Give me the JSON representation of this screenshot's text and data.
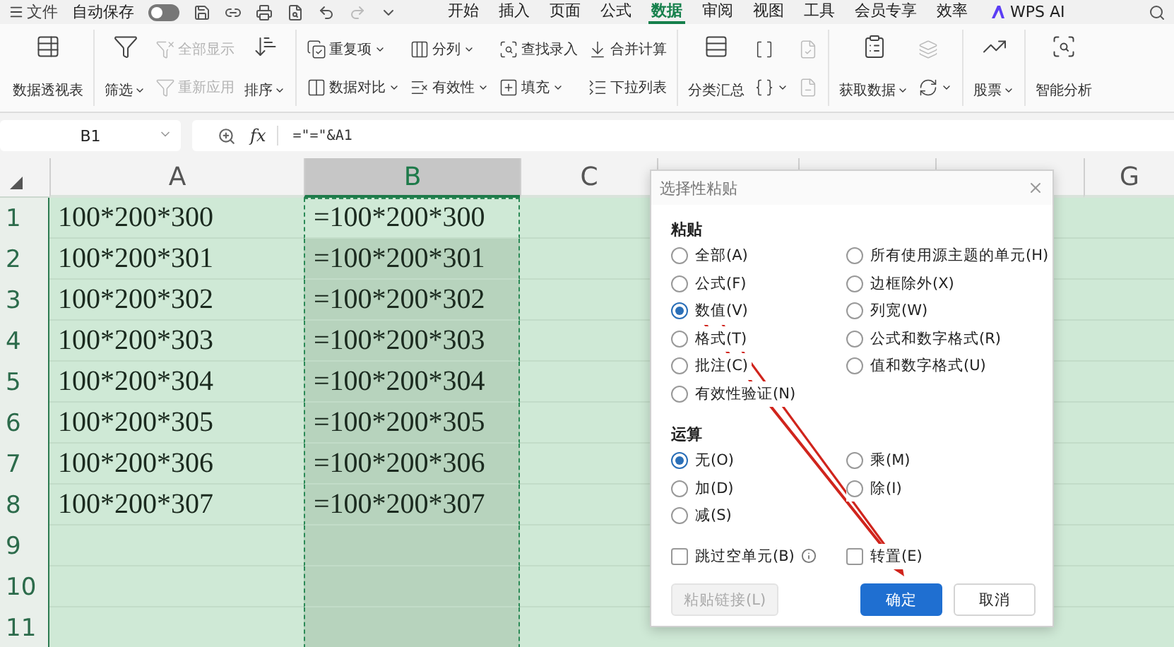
{
  "title_bar": {
    "menu": "文件",
    "autosave": {
      "label": "自动保存",
      "on": false
    },
    "tabs": [
      {
        "label": "开始",
        "selected": false
      },
      {
        "label": "插入",
        "selected": false
      },
      {
        "label": "页面",
        "selected": false
      },
      {
        "label": "公式",
        "selected": false
      },
      {
        "label": "数据",
        "selected": true
      },
      {
        "label": "审阅",
        "selected": false
      },
      {
        "label": "视图",
        "selected": false
      },
      {
        "label": "工具",
        "selected": false
      },
      {
        "label": "会员专享",
        "selected": false
      },
      {
        "label": "效率",
        "selected": false
      }
    ],
    "ai": "WPS AI"
  },
  "ribbon": [
    [
      {
        "kind": "large",
        "label": "数据透视表",
        "dropdown": false
      }
    ],
    [
      {
        "kind": "large",
        "label": "筛选",
        "dropdown": true
      },
      {
        "kind": "stack",
        "items": [
          {
            "label": "全部显示",
            "dropdown": false,
            "disabled": true
          },
          {
            "label": "重新应用",
            "dropdown": false,
            "disabled": true
          }
        ]
      },
      {
        "kind": "large",
        "label": "排序",
        "dropdown": true
      }
    ],
    [
      {
        "kind": "stack",
        "items": [
          {
            "label": "重复项",
            "dropdown": true,
            "disabled": false
          },
          {
            "label": "数据对比",
            "dropdown": true,
            "disabled": false
          }
        ]
      },
      {
        "kind": "stack",
        "items": [
          {
            "label": "分列",
            "dropdown": true,
            "disabled": false
          },
          {
            "label": "有效性",
            "dropdown": true,
            "disabled": false
          }
        ]
      },
      {
        "kind": "stack",
        "items": [
          {
            "label": "查找录入",
            "dropdown": false,
            "disabled": false
          },
          {
            "label": "填充",
            "dropdown": true,
            "disabled": false
          }
        ]
      },
      {
        "kind": "stack",
        "items": [
          {
            "label": "合并计算",
            "dropdown": false,
            "disabled": false
          },
          {
            "label": "下拉列表",
            "dropdown": false,
            "disabled": false
          }
        ]
      }
    ],
    [
      {
        "kind": "large",
        "label": "分类汇总",
        "dropdown": false
      },
      {
        "kind": "stack",
        "items": [
          {
            "dropdown": false,
            "disabled": false
          },
          {
            "dropdown": true,
            "disabled": false
          }
        ]
      },
      {
        "kind": "stack",
        "items": [
          {
            "dropdown": false,
            "disabled": true
          },
          {
            "dropdown": false,
            "disabled": true
          }
        ]
      }
    ],
    [
      {
        "kind": "large",
        "label": "获取数据",
        "dropdown": true
      },
      {
        "kind": "stack",
        "items": [
          {
            "dropdown": false,
            "disabled": true
          },
          {
            "dropdown": true,
            "disabled": false
          }
        ]
      }
    ],
    [
      {
        "kind": "large",
        "label": "股票",
        "dropdown": true
      }
    ],
    [
      {
        "kind": "large",
        "label": "智能分析",
        "dropdown": false
      }
    ]
  ],
  "formula_bar": {
    "name_box": "B1",
    "fx": "fx",
    "formula": "=\"=\"&A1"
  },
  "sheet": {
    "columns": [
      {
        "label": "A",
        "selected": false
      },
      {
        "label": "B",
        "selected": true
      },
      {
        "label": "C",
        "selected": false
      },
      {
        "selected": false
      },
      {
        "selected": false
      },
      {
        "selected": false
      },
      {
        "label": "G",
        "selected": false
      }
    ],
    "rows": [
      {
        "number": "1",
        "cells": [
          "100*200*300",
          "=100*200*300"
        ]
      },
      {
        "number": "2",
        "cells": [
          "100*200*301",
          "=100*200*301"
        ]
      },
      {
        "number": "3",
        "cells": [
          "100*200*302",
          "=100*200*302"
        ]
      },
      {
        "number": "4",
        "cells": [
          "100*200*303",
          "=100*200*303"
        ]
      },
      {
        "number": "5",
        "cells": [
          "100*200*304",
          "=100*200*304"
        ]
      },
      {
        "number": "6",
        "cells": [
          "100*200*305",
          "=100*200*305"
        ]
      },
      {
        "number": "7",
        "cells": [
          "100*200*306",
          "=100*200*306"
        ]
      },
      {
        "number": "8",
        "cells": [
          "100*200*307",
          "=100*200*307"
        ]
      },
      {
        "number": "9",
        "cells": []
      },
      {
        "number": "10",
        "cells": []
      },
      {
        "number": "11",
        "cells": []
      }
    ]
  },
  "dialog": {
    "title": "选择性粘贴",
    "sections": [
      {
        "title": "粘贴",
        "options": [
          {
            "label": "全部(A)",
            "selected": false
          },
          {
            "label": "所有使用源主题的单元(H)",
            "selected": false
          },
          {
            "label": "公式(F)",
            "selected": false
          },
          {
            "label": "边框除外(X)",
            "selected": false
          },
          {
            "label": "数值(V)",
            "selected": true
          },
          {
            "label": "列宽(W)",
            "selected": false
          },
          {
            "label": "格式(T)",
            "selected": false
          },
          {
            "label": "公式和数字格式(R)",
            "selected": false
          },
          {
            "label": "批注(C)",
            "selected": false
          },
          {
            "label": "值和数字格式(U)",
            "selected": false
          },
          {
            "label": "有效性验证(N)",
            "selected": false
          }
        ]
      },
      {
        "title": "运算",
        "options": [
          {
            "label": "无(O)",
            "selected": true
          },
          {
            "label": "乘(M)",
            "selected": false
          },
          {
            "label": "加(D)",
            "selected": false
          },
          {
            "label": "除(I)",
            "selected": false
          },
          {
            "label": "减(S)",
            "selected": false
          }
        ]
      }
    ],
    "checkboxes": [
      {
        "label": "跳过空单元(B)",
        "checked": false,
        "info": true
      },
      {
        "label": "转置(E)",
        "checked": false,
        "info": false
      }
    ],
    "buttons": [
      {
        "label": "粘贴链接(L)",
        "kind": "secondary",
        "disabled": true
      },
      {
        "label": "确定",
        "kind": "primary",
        "disabled": false
      },
      {
        "label": "取消",
        "kind": "secondary",
        "disabled": false
      }
    ]
  }
}
